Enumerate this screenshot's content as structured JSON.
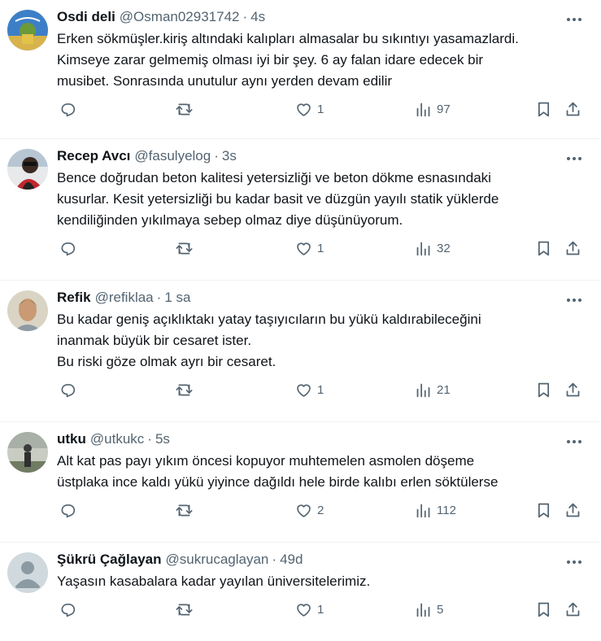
{
  "tweets": [
    {
      "name": "Osdi deli",
      "handle": "@Osman02931742",
      "time": "4s",
      "lines": [
        "Erken sökmüşler.kiriş altındaki kalıpları almasalar bu sıkıntıyı yasamazlardi.",
        "Kimseye zarar gelmemiş olması iyi bir şey. 6 ay falan idare edecek bir",
        "musibet. Sonrasında unutulur aynı yerden devam edilir"
      ],
      "likes": "1",
      "views": "97"
    },
    {
      "name": "Recep Avcı",
      "handle": "@fasulyelog",
      "time": "3s",
      "lines": [
        "Bence doğrudan beton kalitesi yetersizliği ve beton dökme esnasındaki",
        "kusurlar. Kesit yetersizliği bu kadar basit ve düzgün yayılı statik yüklerde",
        "kendiliğinden yıkılmaya sebep olmaz diye düşünüyorum."
      ],
      "likes": "1",
      "views": "32"
    },
    {
      "name": "Refik",
      "handle": "@refiklaa",
      "time": "1 sa",
      "lines": [
        "Bu kadar geniş açıklıktakı yatay taşıyıcıların bu yükü kaldırabileceğini",
        "inanmak büyük bir cesaret ister.",
        "Bu riski göze olmak ayrı bir cesaret."
      ],
      "likes": "1",
      "views": "21"
    },
    {
      "name": "utku",
      "handle": "@utkukc",
      "time": "5s",
      "lines": [
        "Alt kat pas payı yıkım öncesi kopuyor muhtemelen asmolen döşeme",
        "üstplaka ince kaldı yükü yiyince dağıldı hele birde kalıbı erlen söktülerse"
      ],
      "likes": "2",
      "views": "112"
    },
    {
      "name": "Şükrü Çağlayan",
      "handle": "@sukrucaglayan",
      "time": "49d",
      "lines": [
        "Yaşasın kasabalara kadar yayılan üniversitelerimiz."
      ],
      "likes": "1",
      "views": "5"
    }
  ],
  "separator": "·",
  "colors": {
    "text": "#0f1419",
    "secondary": "#536471",
    "border": "#eff3f4"
  },
  "icons": [
    "more-icon",
    "reply-icon",
    "retweet-icon",
    "like-icon",
    "views-icon",
    "bookmark-icon",
    "share-icon"
  ]
}
